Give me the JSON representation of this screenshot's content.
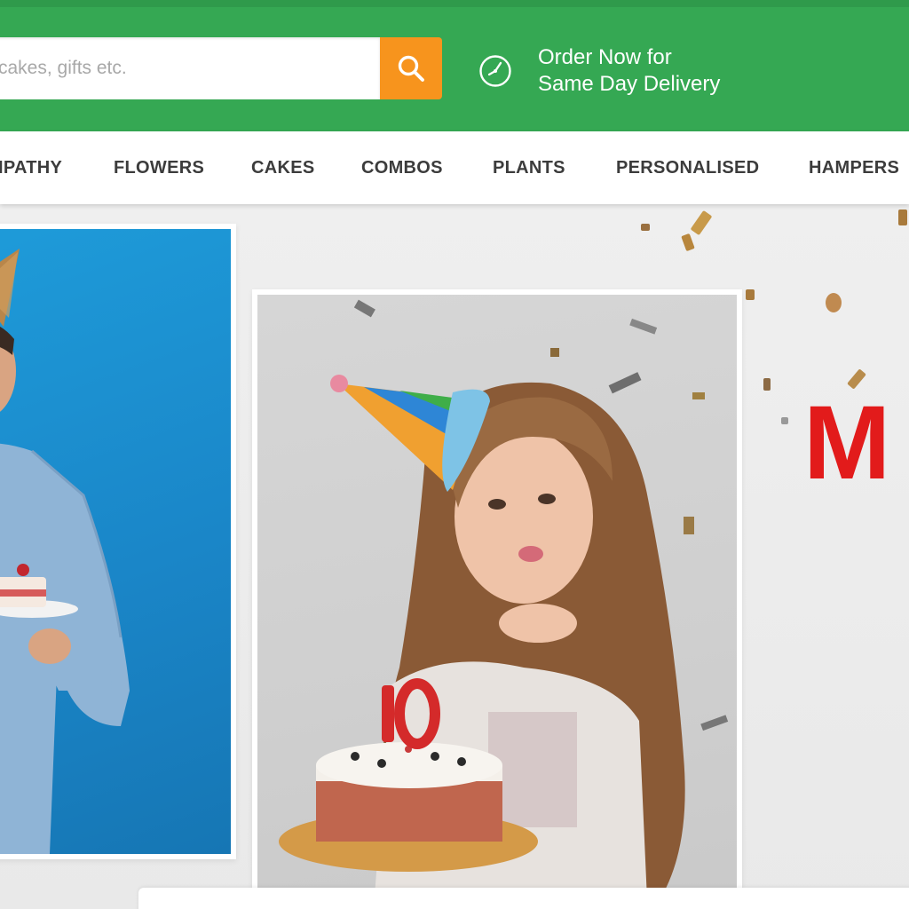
{
  "search": {
    "placeholder": "cakes, gifts etc."
  },
  "promo": {
    "line1": "Order Now for",
    "line2": "Same Day Delivery",
    "icon": "clock-icon"
  },
  "nav": {
    "items": [
      {
        "label": "IPATHY"
      },
      {
        "label": "FLOWERS"
      },
      {
        "label": "CAKES"
      },
      {
        "label": "COMBOS"
      },
      {
        "label": "PLANTS"
      },
      {
        "label": "PERSONALISED"
      },
      {
        "label": "HAMPERS"
      }
    ]
  },
  "banner": {
    "headline": "M",
    "images": [
      {
        "description": "man-with-cake-photo"
      },
      {
        "description": "girl-with-birthday-cake-photo"
      }
    ]
  },
  "colors": {
    "header_green": "#35a853",
    "search_orange": "#f7941d",
    "headline_red": "#e21b1b",
    "nav_text": "#3c3c3c"
  }
}
